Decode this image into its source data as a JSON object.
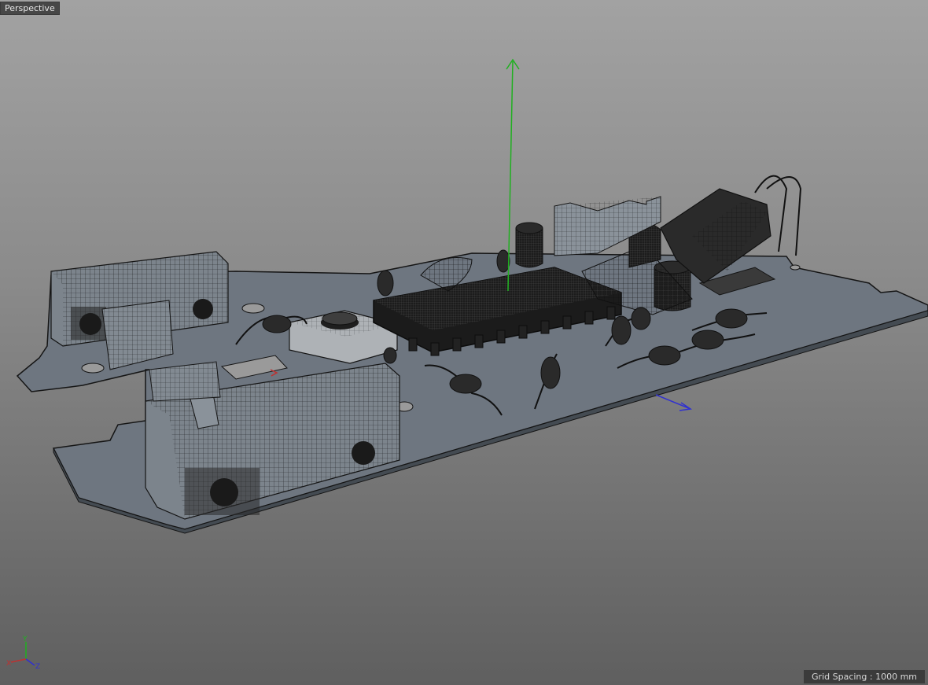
{
  "viewport": {
    "view_label": "Perspective",
    "grid_spacing": "Grid Spacing : 1000 mm"
  },
  "axes_gizmo": {
    "x": "X",
    "y": "Y",
    "z": "Z"
  },
  "colors": {
    "background_top": "#a2a2a2",
    "background_bottom": "#5f5f5f",
    "board": "#6e7680",
    "wireframe": "#151515",
    "axis_x": "#c03030",
    "axis_y": "#20b020",
    "axis_z": "#3030d0"
  },
  "icons": [
    "axis-y-handle",
    "axis-z-handle",
    "axis-x-handle",
    "axes-gizmo-icon"
  ]
}
